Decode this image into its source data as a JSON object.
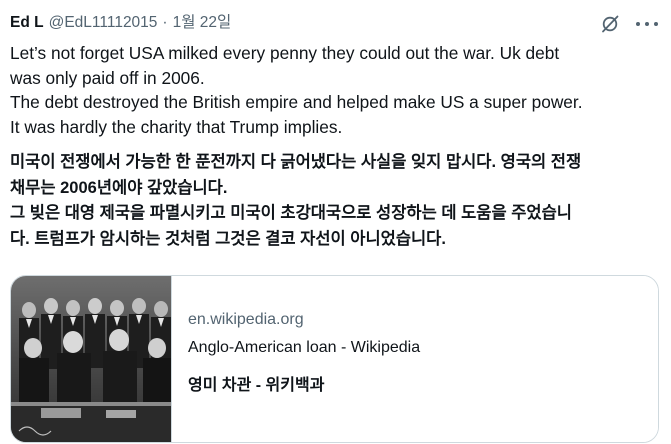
{
  "tweet": {
    "author_name": "Ed L",
    "handle": "@EdL11112015",
    "separator": "·",
    "date": "1월 22일",
    "text_lines": [
      "Let’s not forget USA milked every penny they could out the war.  Uk debt",
      "was only paid off in 2006.",
      "The debt destroyed the British empire and helped make US a super power.",
      "It was hardly the charity that Trump implies."
    ],
    "translation_lines": [
      "미국이 전쟁에서 가능한 한 푼전까지 다 긁어냈다는 사실을 잊지 맙시다. 영국의 전쟁",
      "채무는 2006년에야 갚았습니다.",
      "그 빚은 대영 제국을 파멸시키고 미국이 초강대국으로 성장하는 데 도움을 주었습니",
      "다. 트럼프가 암시하는 것처럼 그것은 결코 자선이 아니었습니다."
    ]
  },
  "card": {
    "domain": "en.wikipedia.org",
    "title": "Anglo-American loan - Wikipedia",
    "translated_title": "영미 차관 - 위키백과",
    "image_desc": "historical-photo-thumbnail"
  },
  "icons": {
    "grok": "grok-icon",
    "more": "more-icon"
  },
  "colors": {
    "text": "#0f1419",
    "secondary": "#536471",
    "border": "#cfd9de"
  }
}
